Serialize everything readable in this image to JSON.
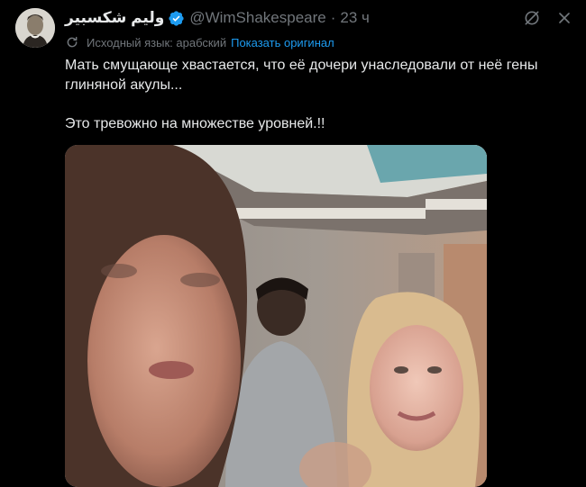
{
  "author": {
    "display_name": "وليم شكسبير",
    "handle": "@WimShakespeare",
    "separator": "·",
    "time": "23 ч",
    "verified_icon": "verified-badge-icon",
    "avatar_icon": "shakespeare-portrait"
  },
  "translation": {
    "source_text": "Исходный язык: арабский",
    "show_original_label": "Показать оригинал"
  },
  "tweet": {
    "line1": "Мать смущающе хвастается, что её дочери унаследовали от неё гены",
    "line2": "глиняной акулы...",
    "line3": "Это тревожно на множестве уровней.!!"
  },
  "actions": {
    "grok_icon": "grok-icon",
    "more_icon": "more-icon"
  },
  "colors": {
    "background": "#000000",
    "text": "#e7e9ea",
    "muted": "#71767b",
    "link": "#1d9bf0",
    "verified": "#1d9bf0"
  }
}
